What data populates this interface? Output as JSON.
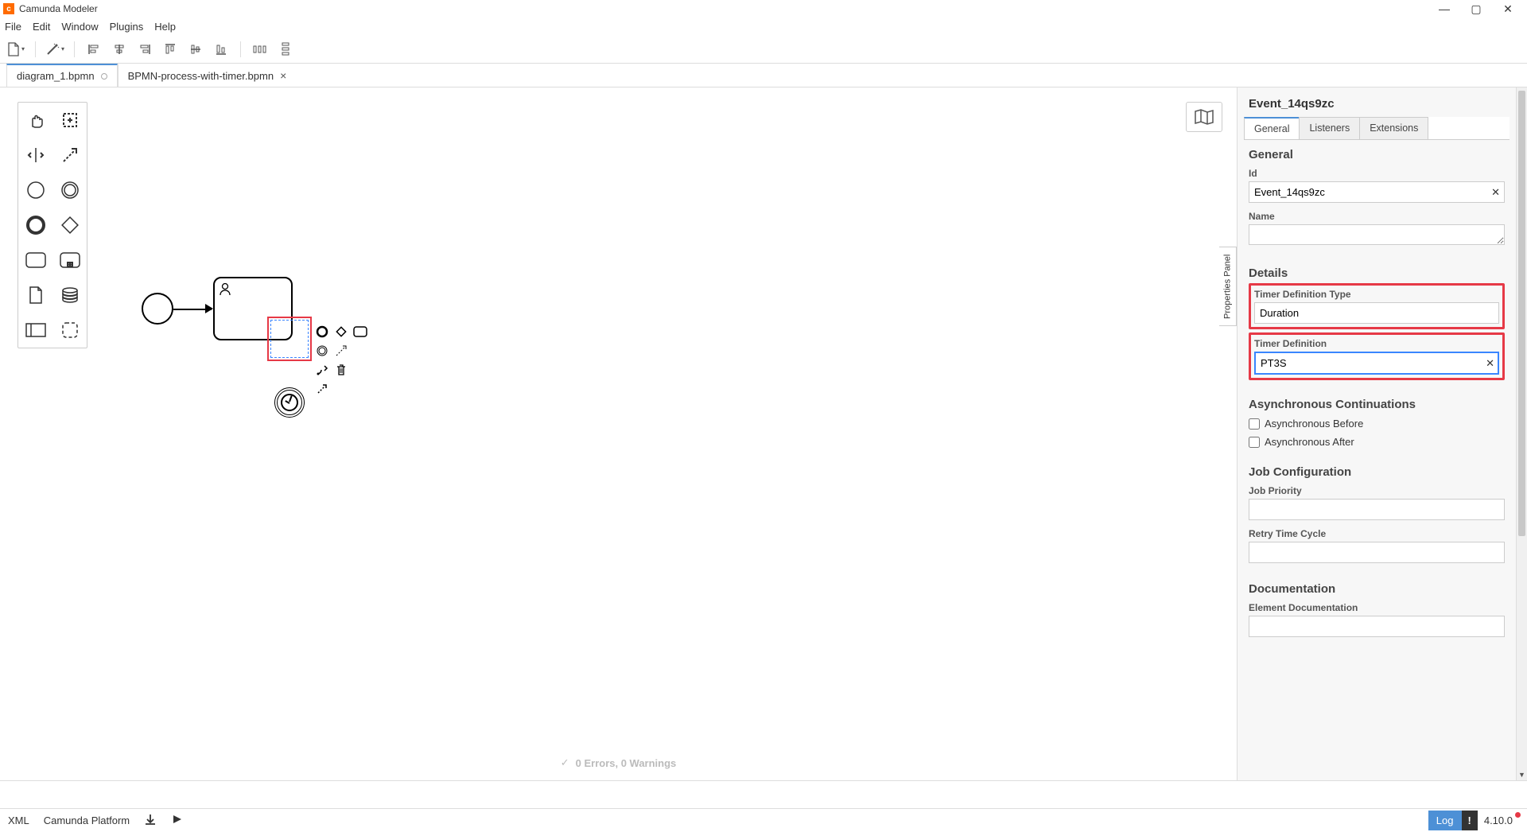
{
  "window": {
    "title": "Camunda Modeler"
  },
  "menus": {
    "file": "File",
    "edit": "Edit",
    "window": "Window",
    "plugins": "Plugins",
    "help": "Help"
  },
  "tabs": [
    {
      "label": "diagram_1.bpmn",
      "dirty": false,
      "active": true
    },
    {
      "label": "BPMN-process-with-timer.bpmn",
      "dirty": false,
      "active": false
    }
  ],
  "validation": {
    "text": "0 Errors, 0 Warnings"
  },
  "properties": {
    "toggle_label": "Properties Panel",
    "header": "Event_14qs9zc",
    "tabs": {
      "general": "General",
      "listeners": "Listeners",
      "extensions": "Extensions"
    },
    "sections": {
      "general": {
        "title": "General",
        "id_label": "Id",
        "id_value": "Event_14qs9zc",
        "name_label": "Name",
        "name_value": ""
      },
      "details": {
        "title": "Details",
        "tdt_label": "Timer Definition Type",
        "tdt_value": "Duration",
        "td_label": "Timer Definition",
        "td_value": "PT3S"
      },
      "async": {
        "title": "Asynchronous Continuations",
        "before": "Asynchronous Before",
        "after": "Asynchronous After"
      },
      "jobconf": {
        "title": "Job Configuration",
        "priority_label": "Job Priority",
        "priority_value": "",
        "retry_label": "Retry Time Cycle",
        "retry_value": ""
      },
      "doc": {
        "title": "Documentation",
        "eldoc_label": "Element Documentation",
        "eldoc_value": ""
      }
    }
  },
  "statusbar": {
    "xml": "XML",
    "platform": "Camunda Platform",
    "log": "Log",
    "warn_glyph": "!",
    "version": "4.10.0"
  }
}
